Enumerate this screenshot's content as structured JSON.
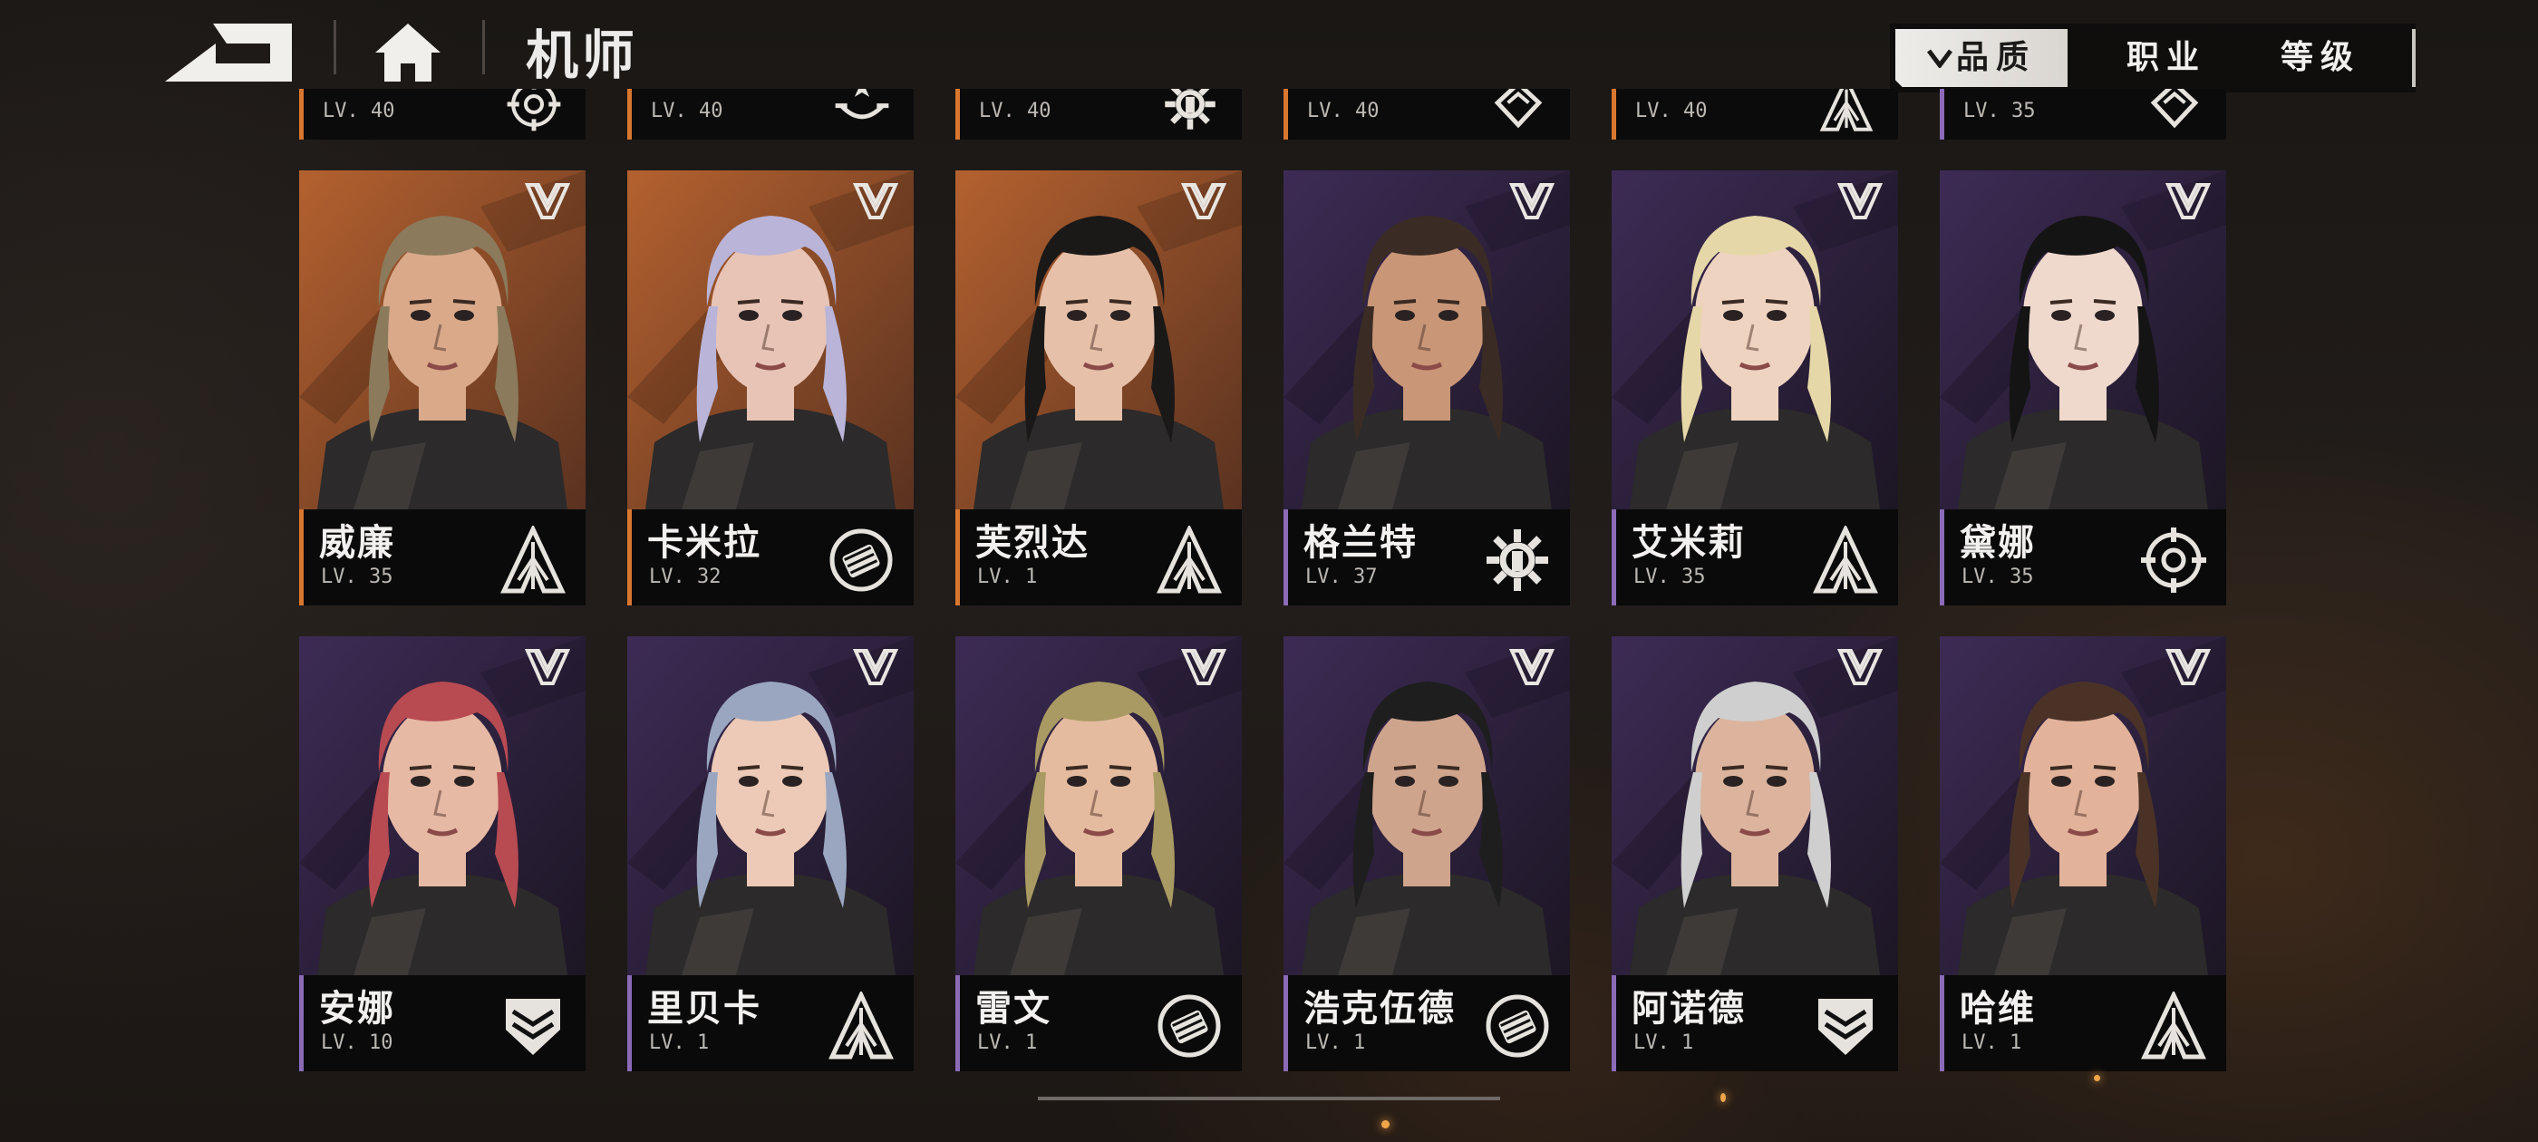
{
  "header": {
    "title": "机师",
    "back_icon": "back-arrow-icon",
    "home_icon": "home-icon"
  },
  "sort": {
    "tabs": [
      {
        "label": "品质",
        "active": true,
        "indicator": "chevron-down-icon"
      },
      {
        "label": "职业",
        "active": false
      },
      {
        "label": "等级",
        "active": false
      }
    ]
  },
  "partial_row": [
    {
      "level": "LV. 40",
      "stripe": "orange",
      "class": "sniper"
    },
    {
      "level": "LV. 40",
      "stripe": "orange",
      "class": "support"
    },
    {
      "level": "LV. 40",
      "stripe": "orange",
      "class": "engineer"
    },
    {
      "level": "LV. 40",
      "stripe": "orange",
      "class": "tank"
    },
    {
      "level": "LV. 40",
      "stripe": "orange",
      "class": "assault"
    },
    {
      "level": "LV. 35",
      "stripe": "purple",
      "class": "tank"
    }
  ],
  "pilots": [
    {
      "name": "威廉",
      "level": "LV. 35",
      "rarity": "orange",
      "class": "assault"
    },
    {
      "name": "卡米拉",
      "level": "LV. 32",
      "rarity": "orange",
      "class": "striker"
    },
    {
      "name": "芙烈达",
      "level": "LV. 1",
      "rarity": "orange",
      "class": "assault"
    },
    {
      "name": "格兰特",
      "level": "LV. 37",
      "rarity": "purple",
      "class": "engineer"
    },
    {
      "name": "艾米莉",
      "level": "LV. 35",
      "rarity": "purple",
      "class": "assault"
    },
    {
      "name": "黛娜",
      "level": "LV. 35",
      "rarity": "purple",
      "class": "sniper"
    },
    {
      "name": "安娜",
      "level": "LV. 10",
      "rarity": "purple",
      "class": "defender"
    },
    {
      "name": "里贝卡",
      "level": "LV. 1",
      "rarity": "purple",
      "class": "assault"
    },
    {
      "name": "雷文",
      "level": "LV. 1",
      "rarity": "purple",
      "class": "striker"
    },
    {
      "name": "浩克伍德",
      "level": "LV. 1",
      "rarity": "purple",
      "class": "striker"
    },
    {
      "name": "阿诺德",
      "level": "LV. 1",
      "rarity": "purple",
      "class": "defender"
    },
    {
      "name": "哈维",
      "level": "LV. 1",
      "rarity": "purple",
      "class": "assault"
    }
  ],
  "colors": {
    "orange_rarity": "#a8552a",
    "purple_rarity": "#3a2850",
    "accent_stripe_orange": "#d9772f",
    "accent_stripe_purple": "#7a5aa6"
  }
}
